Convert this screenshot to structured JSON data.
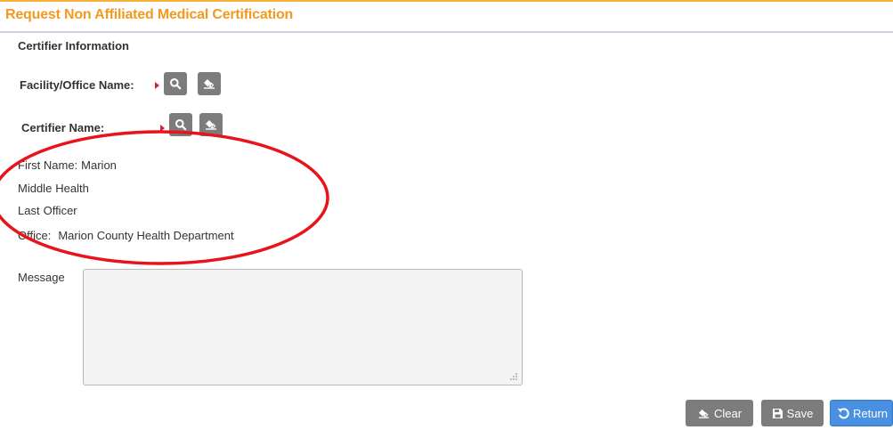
{
  "header": {
    "title": "Request Non Affiliated Medical Certification"
  },
  "certifier_section": {
    "heading": "Certifier Information",
    "facility_label": "Facility/Office Name:",
    "certifier_label": "Certifier Name:",
    "first_name_label": "First Name:",
    "first_name_value": "Marion",
    "middle_label": "Middle",
    "middle_value": "Health",
    "last_label": "Last",
    "last_value": "Officer",
    "office_label": "Office:",
    "office_value": "Marion County Health Department"
  },
  "message": {
    "label": "Message",
    "value": ""
  },
  "actions": {
    "clear_label": "Clear",
    "save_label": "Save",
    "return_label": "Return"
  },
  "colors": {
    "title": "#f39a1e",
    "top_rule": "#f5b13a",
    "gray_button": "#7c7c7c",
    "return_button": "#4a90e2",
    "required_marker": "#cc2a2a",
    "annotation_ellipse": "#e8141c"
  },
  "icons": {
    "search": "search-icon",
    "eraser": "eraser-icon",
    "save": "floppy-disk-icon",
    "return": "undo-arrow-icon"
  }
}
